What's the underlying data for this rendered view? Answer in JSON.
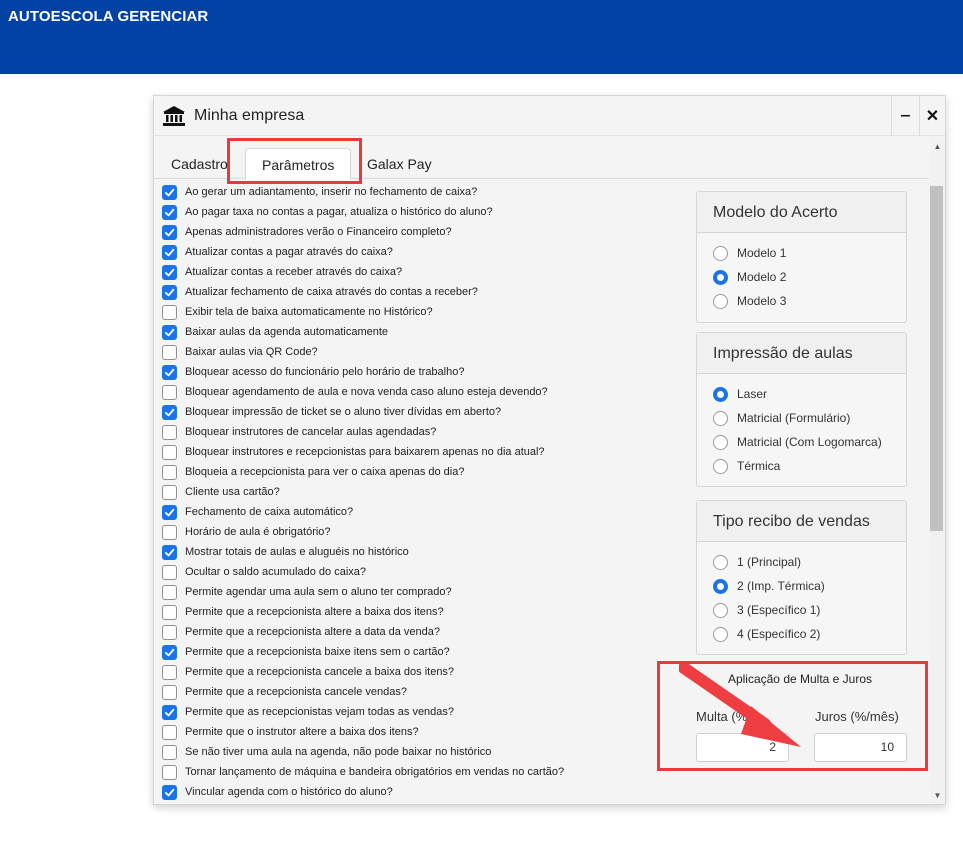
{
  "app": {
    "title": "AUTOESCOLA GERENCIAR"
  },
  "window": {
    "title": "Minha empresa",
    "icon": "bank-icon",
    "minimize_label": "‒",
    "close_label": "✕"
  },
  "tabs": [
    {
      "label": "Cadastro",
      "active": false
    },
    {
      "label": "Parâmetros",
      "active": true
    },
    {
      "label": "Galax Pay",
      "active": false
    }
  ],
  "options": [
    {
      "label": "Ao gerar um adiantamento, inserir no fechamento de caixa?",
      "checked": true
    },
    {
      "label": "Ao pagar taxa no contas a pagar, atualiza o histórico do aluno?",
      "checked": true
    },
    {
      "label": "Apenas administradores verão o Financeiro completo?",
      "checked": true
    },
    {
      "label": "Atualizar contas a pagar através do caixa?",
      "checked": true
    },
    {
      "label": "Atualizar contas a receber através do caixa?",
      "checked": true
    },
    {
      "label": "Atualizar fechamento de caixa através do contas a receber?",
      "checked": true
    },
    {
      "label": "Exibir tela de baixa automaticamente no Histórico?",
      "checked": false
    },
    {
      "label": "Baixar aulas da agenda automaticamente",
      "checked": true
    },
    {
      "label": "Baixar aulas via QR Code?",
      "checked": false
    },
    {
      "label": "Bloquear acesso do funcionário pelo horário de trabalho?",
      "checked": true
    },
    {
      "label": "Bloquear agendamento de aula e nova venda caso aluno esteja devendo?",
      "checked": false
    },
    {
      "label": "Bloquear impressão de ticket se o aluno tiver dívidas em aberto?",
      "checked": true
    },
    {
      "label": "Bloquear instrutores de cancelar aulas agendadas?",
      "checked": false
    },
    {
      "label": "Bloquear instrutores e recepcionistas para baixarem apenas no dia atual?",
      "checked": false
    },
    {
      "label": "Bloqueia a recepcionista para ver o caixa apenas do dia?",
      "checked": false
    },
    {
      "label": "Cliente usa cartão?",
      "checked": false
    },
    {
      "label": "Fechamento de caixa automático?",
      "checked": true
    },
    {
      "label": "Horário de aula é obrigatório?",
      "checked": false
    },
    {
      "label": "Mostrar totais de aulas e aluguéis no histórico",
      "checked": true
    },
    {
      "label": "Ocultar o saldo acumulado do caixa?",
      "checked": false
    },
    {
      "label": "Permite agendar uma aula sem o aluno ter comprado?",
      "checked": false
    },
    {
      "label": "Permite que a recepcionista altere a baixa dos itens?",
      "checked": false
    },
    {
      "label": "Permite que a recepcionista altere a data da venda?",
      "checked": false
    },
    {
      "label": "Permite que a recepcionista baixe itens sem o cartão?",
      "checked": true
    },
    {
      "label": "Permite que a recepcionista cancele a baixa dos itens?",
      "checked": false
    },
    {
      "label": "Permite que a recepcionista cancele vendas?",
      "checked": false
    },
    {
      "label": "Permite que as recepcionistas vejam todas as vendas?",
      "checked": true
    },
    {
      "label": "Permite que o instrutor altere a baixa dos itens?",
      "checked": false
    },
    {
      "label": "Se não tiver uma aula na agenda, não pode baixar no histórico",
      "checked": false
    },
    {
      "label": "Tornar lançamento de máquina e bandeira obrigatórios em vendas no cartão?",
      "checked": false
    },
    {
      "label": "Vincular agenda com o histórico do aluno?",
      "checked": true
    }
  ],
  "panels": [
    {
      "title": "Modelo do Acerto",
      "options": [
        {
          "label": "Modelo 1",
          "selected": false
        },
        {
          "label": "Modelo 2",
          "selected": true
        },
        {
          "label": "Modelo 3",
          "selected": false
        }
      ]
    },
    {
      "title": "Impressão de aulas",
      "options": [
        {
          "label": "Laser",
          "selected": true
        },
        {
          "label": "Matricial (Formulário)",
          "selected": false
        },
        {
          "label": "Matricial (Com Logomarca)",
          "selected": false
        },
        {
          "label": "Térmica",
          "selected": false
        }
      ]
    },
    {
      "title": "Tipo recibo de vendas",
      "options": [
        {
          "label": "1 (Principal)",
          "selected": false
        },
        {
          "label": "2 (Imp. Térmica)",
          "selected": true
        },
        {
          "label": "3 (Específico 1)",
          "selected": false
        },
        {
          "label": "4 (Específico 2)",
          "selected": false
        }
      ]
    }
  ],
  "multa_juros": {
    "title": "Aplicação de Multa e Juros",
    "multa_label": "Multa (%)",
    "multa_value": "2",
    "juros_label": "Juros (%/mês)",
    "juros_value": "10"
  },
  "colors": {
    "topbar": "#0142a4",
    "accent": "#1a73e8",
    "highlight": "#e63a3d"
  }
}
